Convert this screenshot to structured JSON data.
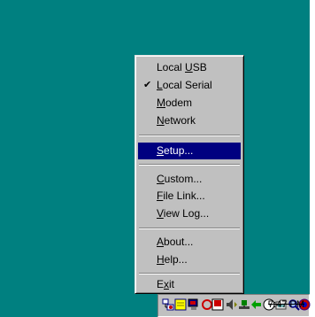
{
  "menu": {
    "items": [
      {
        "label": "Local USB",
        "mnemonic": "U",
        "checked": false,
        "highlighted": false
      },
      {
        "label": "Local Serial",
        "mnemonic": "L",
        "checked": true,
        "highlighted": false
      },
      {
        "label": "Modem",
        "mnemonic": "M",
        "checked": false,
        "highlighted": false
      },
      {
        "label": "Network",
        "mnemonic": "N",
        "checked": false,
        "highlighted": false
      },
      {
        "label": "Setup...",
        "mnemonic": "S",
        "checked": false,
        "highlighted": true
      },
      {
        "label": "Custom...",
        "mnemonic": "C",
        "checked": false,
        "highlighted": false
      },
      {
        "label": "File Link...",
        "mnemonic": "F",
        "checked": false,
        "highlighted": false
      },
      {
        "label": "View Log...",
        "mnemonic": "V",
        "checked": false,
        "highlighted": false
      },
      {
        "label": "About...",
        "mnemonic": "A",
        "checked": false,
        "highlighted": false
      },
      {
        "label": "Help...",
        "mnemonic": "H",
        "checked": false,
        "highlighted": false
      },
      {
        "label": "Exit",
        "mnemonic": "x",
        "checked": false,
        "highlighted": false
      }
    ],
    "check_glyph": "✔"
  },
  "taskbar": {
    "clock": "7:47 PM",
    "tray_icons": [
      "network-icon",
      "notepad-icon",
      "monitor-icon",
      "record-icon",
      "acrobat-icon",
      "speaker-icon",
      "link-icon",
      "chat-icon",
      "clock-icon",
      "folder-icon",
      "search-icon",
      "globe-icon"
    ]
  },
  "colors": {
    "desktop": "#008080",
    "menu_bg": "#c0c0c0",
    "highlight": "#000080"
  }
}
